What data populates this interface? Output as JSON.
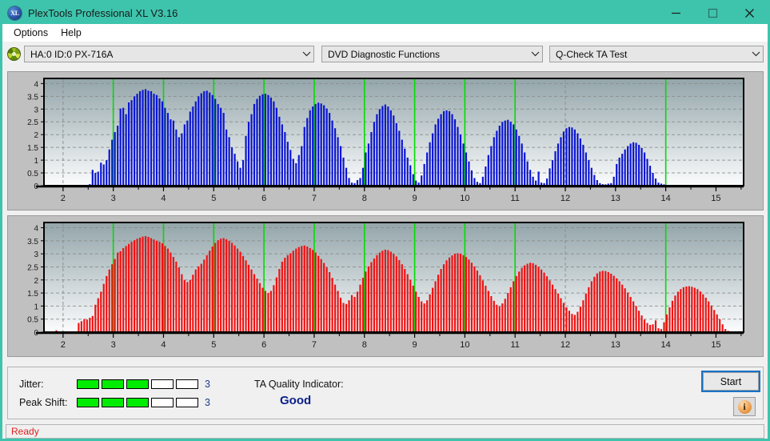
{
  "window": {
    "title": "PlexTools Professional XL V3.16",
    "app_icon": "XL",
    "minimize_icon": "minimize-icon",
    "maximize_icon": "maximize-icon",
    "close_icon": "close-icon",
    "titlebar_color": "#3ec4ad"
  },
  "menu": {
    "items": [
      {
        "label": "Options"
      },
      {
        "label": "Help"
      }
    ]
  },
  "toolbar": {
    "drive_icon": "disc-icon",
    "drive_select": {
      "value": "HA:0 ID:0  PX-716A"
    },
    "function_select": {
      "value": "DVD Diagnostic Functions"
    },
    "test_select": {
      "value": "Q-Check TA Test"
    }
  },
  "results": {
    "jitter_label": "Jitter:",
    "jitter_value": "3",
    "jitter_segments_on": 3,
    "jitter_segments_total": 5,
    "peak_shift_label": "Peak Shift:",
    "peak_shift_value": "3",
    "peak_shift_segments_on": 3,
    "peak_shift_segments_total": 5,
    "ta_quality_label": "TA Quality Indicator:",
    "ta_quality_value": "Good",
    "ta_quality_color": "#0b1e8c",
    "segment_on_color": "#00ec00",
    "start_button": "Start",
    "info_button": "i"
  },
  "statusbar": {
    "text": "Ready"
  },
  "chart_data": [
    {
      "id": "jitter-chart",
      "type": "bar",
      "title": "",
      "xlabel": "",
      "ylabel": "",
      "series_color": "#0a14d2",
      "marker_color": "#00dd00",
      "background_gradient": [
        "#93a5aa",
        "#fbfcfd"
      ],
      "grid": true,
      "xlim": [
        1.62,
        15.55
      ],
      "ylim": [
        0,
        4.2
      ],
      "yticks": [
        0,
        0.5,
        1,
        1.5,
        2,
        2.5,
        3,
        3.5,
        4
      ],
      "ytick_labels": [
        "0",
        "0.5",
        "1",
        "1.5",
        "2",
        "2.5",
        "3",
        "3.5",
        "4"
      ],
      "xticks": [
        2,
        3,
        4,
        5,
        6,
        7,
        8,
        9,
        10,
        11,
        12,
        13,
        14,
        15
      ],
      "xtick_labels": [
        "2",
        "3",
        "4",
        "5",
        "6",
        "7",
        "8",
        "9",
        "10",
        "11",
        "12",
        "13",
        "14",
        "15"
      ],
      "markers": [
        3,
        4,
        5,
        6,
        7,
        8,
        9,
        10,
        11,
        14
      ],
      "bar_step": 0.0555,
      "x_start": 1.7,
      "values": [
        0,
        0,
        0,
        0,
        0,
        0,
        0,
        0,
        0,
        0,
        0,
        0,
        0,
        0,
        0,
        0.06,
        0.62,
        0.5,
        0.55,
        0.9,
        0.83,
        1.0,
        1.42,
        1.8,
        2.1,
        2.35,
        3.02,
        3.05,
        2.8,
        3.26,
        3.35,
        3.5,
        3.6,
        3.7,
        3.75,
        3.78,
        3.72,
        3.7,
        3.6,
        3.55,
        3.42,
        3.3,
        3.05,
        2.85,
        2.6,
        2.55,
        2.2,
        1.9,
        2.05,
        2.4,
        2.55,
        2.9,
        3.1,
        3.3,
        3.5,
        3.62,
        3.7,
        3.72,
        3.65,
        3.55,
        3.4,
        3.2,
        3.05,
        2.85,
        2.2,
        1.9,
        1.5,
        1.25,
        0.95,
        0.7,
        1.0,
        1.95,
        2.5,
        2.8,
        3.2,
        3.4,
        3.52,
        3.58,
        3.6,
        3.55,
        3.45,
        3.3,
        3.05,
        2.7,
        2.4,
        2.1,
        1.72,
        1.4,
        1.05,
        0.88,
        1.2,
        1.55,
        2.3,
        2.65,
        2.95,
        3.1,
        3.2,
        3.25,
        3.22,
        3.15,
        3.02,
        2.85,
        2.55,
        2.25,
        1.9,
        1.55,
        1.1,
        0.7,
        0.3,
        0.12,
        0.1,
        0.22,
        0.3,
        0.7,
        1.3,
        1.65,
        2.1,
        2.5,
        2.8,
        3.0,
        3.12,
        3.18,
        3.1,
        2.95,
        2.75,
        2.45,
        2.15,
        1.8,
        1.45,
        1.1,
        0.8,
        0.45,
        0.2,
        0.12,
        0.4,
        0.85,
        1.3,
        1.7,
        2.05,
        2.4,
        2.62,
        2.8,
        2.92,
        2.95,
        2.92,
        2.8,
        2.6,
        2.3,
        2.0,
        1.65,
        1.3,
        0.95,
        0.6,
        0.3,
        0.15,
        0.1,
        0.35,
        0.75,
        1.2,
        1.55,
        1.9,
        2.15,
        2.35,
        2.5,
        2.55,
        2.58,
        2.5,
        2.4,
        2.2,
        1.95,
        1.65,
        1.3,
        0.95,
        0.62,
        0.35,
        0.2,
        0.55,
        0.12,
        0.1,
        0.28,
        0.68,
        1.0,
        1.35,
        1.65,
        1.9,
        2.12,
        2.25,
        2.3,
        2.28,
        2.2,
        2.05,
        1.85,
        1.6,
        1.3,
        1.0,
        0.7,
        0.42,
        0.22,
        0.1,
        0.06,
        0.05,
        0.08,
        0.1,
        0.35,
        0.85,
        1.1,
        1.25,
        1.42,
        1.55,
        1.65,
        1.7,
        1.68,
        1.6,
        1.48,
        1.3,
        1.05,
        0.78,
        0.5,
        0.28,
        0.12,
        0.08,
        0.05,
        0,
        0,
        0,
        0,
        0,
        0,
        0,
        0,
        0,
        0,
        0,
        0,
        0,
        0,
        0,
        0,
        0,
        0,
        0,
        0,
        0,
        0,
        0,
        0,
        0,
        0,
        0,
        0,
        0,
        0,
        0,
        0,
        0,
        0,
        0,
        0,
        0,
        0,
        0,
        0,
        0,
        0,
        0,
        0,
        0,
        0.05,
        0.2,
        0.45,
        0.6,
        0.9,
        1.25,
        1.45,
        1.62,
        1.75,
        1.58,
        1.55,
        1.32,
        0.95,
        0.5,
        0,
        0,
        0,
        0,
        0,
        0,
        0,
        0,
        0,
        0,
        0,
        0,
        0,
        0,
        0,
        0,
        0,
        0,
        0,
        0,
        0,
        0,
        0
      ]
    },
    {
      "id": "peak-shift-chart",
      "type": "bar",
      "title": "",
      "xlabel": "",
      "ylabel": "",
      "series_color": "#f01010",
      "marker_color": "#00dd00",
      "background_gradient": [
        "#93a5aa",
        "#fbfcfd"
      ],
      "grid": true,
      "xlim": [
        1.62,
        15.55
      ],
      "ylim": [
        0,
        4.2
      ],
      "yticks": [
        0,
        0.5,
        1,
        1.5,
        2,
        2.5,
        3,
        3.5,
        4
      ],
      "ytick_labels": [
        "0",
        "0.5",
        "1",
        "1.5",
        "2",
        "2.5",
        "3",
        "3.5",
        "4"
      ],
      "xticks": [
        2,
        3,
        4,
        5,
        6,
        7,
        8,
        9,
        10,
        11,
        12,
        13,
        14,
        15
      ],
      "xtick_labels": [
        "2",
        "3",
        "4",
        "5",
        "6",
        "7",
        "8",
        "9",
        "10",
        "11",
        "12",
        "13",
        "14",
        "15"
      ],
      "markers": [
        3,
        4,
        5,
        6,
        7,
        8,
        9,
        10,
        11,
        14
      ],
      "bar_step": 0.0555,
      "x_start": 1.7,
      "values": [
        0,
        0,
        0,
        0.07,
        0,
        0,
        0,
        0,
        0,
        0,
        0,
        0.35,
        0.42,
        0.5,
        0.48,
        0.55,
        0.62,
        1.05,
        1.3,
        1.55,
        1.85,
        2.15,
        2.4,
        2.6,
        2.8,
        3.05,
        3.1,
        3.22,
        3.3,
        3.38,
        3.46,
        3.52,
        3.58,
        3.62,
        3.66,
        3.68,
        3.65,
        3.6,
        3.55,
        3.5,
        3.46,
        3.4,
        3.3,
        3.2,
        3.05,
        2.88,
        2.7,
        2.48,
        2.22,
        2.0,
        1.92,
        2.0,
        2.2,
        2.4,
        2.52,
        2.62,
        2.78,
        2.95,
        3.12,
        3.28,
        3.42,
        3.52,
        3.58,
        3.6,
        3.56,
        3.5,
        3.42,
        3.32,
        3.2,
        3.08,
        2.92,
        2.75,
        2.58,
        2.4,
        2.22,
        2.05,
        1.88,
        1.7,
        1.58,
        1.5,
        1.58,
        1.8,
        2.1,
        2.42,
        2.7,
        2.85,
        2.95,
        3.02,
        3.12,
        3.2,
        3.26,
        3.3,
        3.32,
        3.28,
        3.22,
        3.15,
        3.05,
        2.92,
        2.8,
        2.65,
        2.48,
        2.3,
        2.08,
        1.82,
        1.58,
        1.32,
        1.12,
        1.08,
        1.22,
        1.42,
        1.35,
        1.55,
        1.82,
        2.08,
        2.32,
        2.52,
        2.68,
        2.82,
        2.95,
        3.05,
        3.12,
        3.16,
        3.14,
        3.08,
        3.0,
        2.9,
        2.76,
        2.6,
        2.42,
        2.22,
        2.0,
        1.78,
        1.55,
        1.35,
        1.18,
        1.1,
        1.22,
        1.45,
        1.7,
        1.95,
        2.2,
        2.42,
        2.6,
        2.75,
        2.86,
        2.94,
        3.0,
        3.02,
        3.0,
        2.95,
        2.88,
        2.78,
        2.66,
        2.52,
        2.36,
        2.18,
        1.98,
        1.78,
        1.58,
        1.38,
        1.2,
        1.05,
        0.98,
        1.1,
        1.28,
        1.5,
        1.72,
        1.95,
        2.15,
        2.32,
        2.46,
        2.56,
        2.62,
        2.66,
        2.64,
        2.58,
        2.5,
        2.4,
        2.28,
        2.14,
        1.98,
        1.82,
        1.65,
        1.48,
        1.3,
        1.12,
        0.95,
        0.82,
        0.7,
        0.66,
        0.78,
        0.98,
        1.22,
        1.48,
        1.72,
        1.95,
        2.12,
        2.25,
        2.32,
        2.35,
        2.34,
        2.3,
        2.24,
        2.16,
        2.06,
        1.95,
        1.82,
        1.68,
        1.52,
        1.35,
        1.18,
        1.0,
        0.82,
        0.64,
        0.48,
        0.35,
        0.28,
        0.3,
        0.45,
        0.15,
        0.12,
        0.38,
        0.68,
        0.95,
        1.2,
        1.4,
        1.55,
        1.65,
        1.72,
        1.75,
        1.76,
        1.74,
        1.7,
        1.65,
        1.56,
        1.45,
        1.32,
        1.18,
        1.02,
        0.85,
        0.68,
        0.5,
        0.3,
        0.12,
        0.05,
        0,
        0,
        0,
        0,
        0,
        0,
        0,
        0,
        0,
        0,
        0,
        0,
        0,
        0,
        0,
        0,
        0,
        0,
        0,
        0,
        0,
        0,
        0,
        0,
        0,
        0,
        0,
        0.1,
        0.25,
        0.45,
        0.8,
        1.05,
        1.3,
        1.6,
        1.95,
        2.1,
        2.05,
        1.95,
        1.82,
        1.6,
        1.2,
        0.85,
        0,
        0,
        0,
        0,
        0,
        0,
        0,
        0,
        0,
        0,
        0,
        0,
        0,
        0,
        0,
        0,
        0,
        0,
        0,
        0
      ]
    }
  ]
}
